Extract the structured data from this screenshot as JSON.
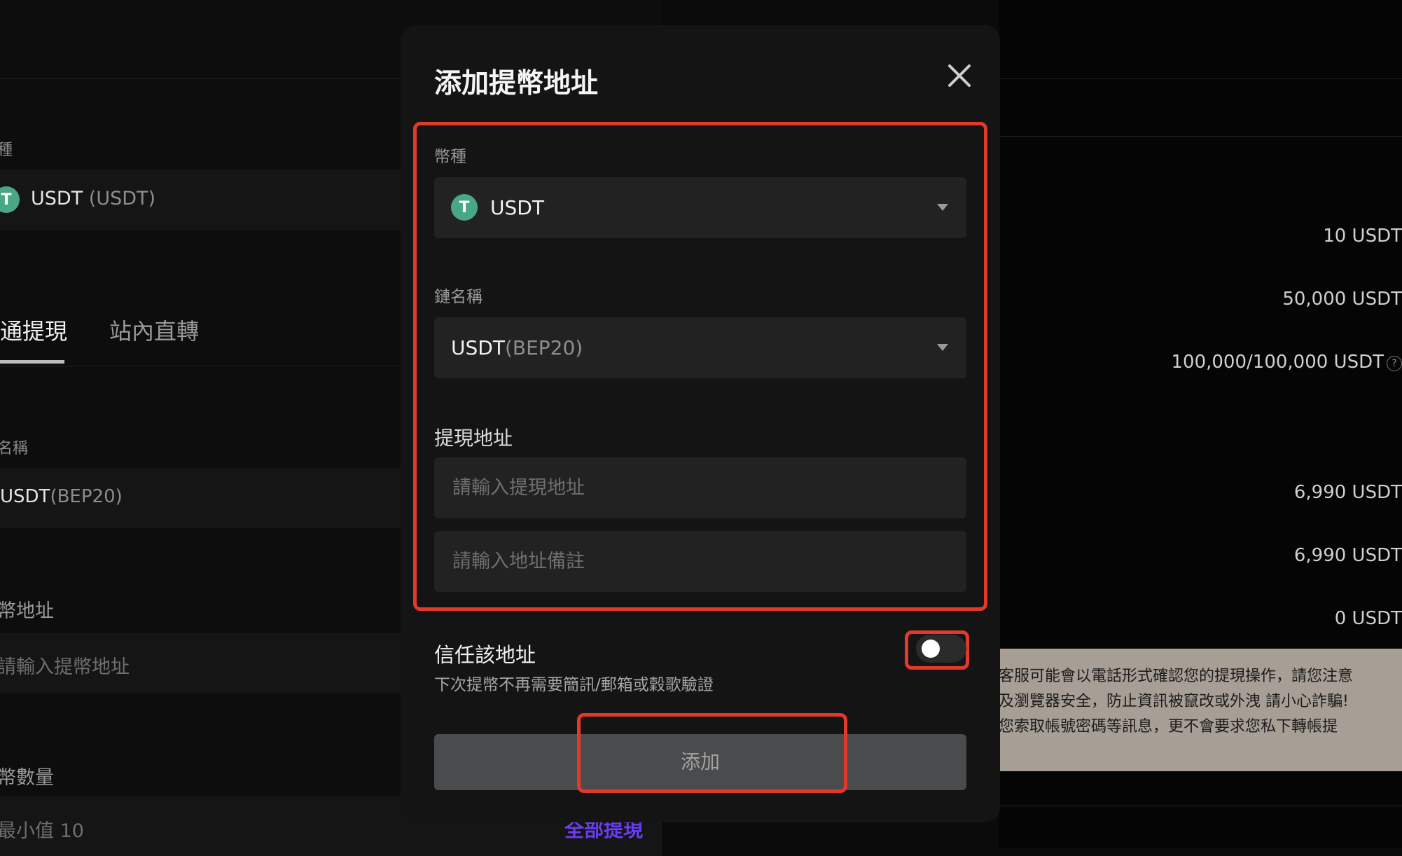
{
  "background": {
    "currency_label": "種",
    "currency_value": "USDT",
    "currency_code": "(USDT)",
    "tabs": [
      "通提現",
      "站內直轉"
    ],
    "chain_label": "名稱",
    "chain_value": "USDT",
    "chain_code": "(BEP20)",
    "address_label": "幣地址",
    "address_placeholder": "請輸入提幣地址",
    "amount_label": "幣數量",
    "amount_placeholder": "最小值 10",
    "withdraw_all_link": "全部提現",
    "right_values": [
      "10 USDT",
      "50,000 USDT",
      "100,000/100,000 USDT",
      "6,990 USDT",
      "6,990 USDT",
      "0 USDT"
    ],
    "help_glyph": "?",
    "notice_lines": [
      "客服可能會以電話形式確認您的提現操作，請您注意",
      "及瀏覽器安全，防止資訊被竄改或外洩 請小心詐騙!",
      "您索取帳號密碼等訊息，更不會要求您私下轉帳提"
    ]
  },
  "modal": {
    "title": "添加提幣地址",
    "currency_label": "幣種",
    "currency_value": "USDT",
    "chain_label": "鏈名稱",
    "chain_value": "USDT",
    "chain_code": "(BEP20)",
    "address_section": "提現地址",
    "address_placeholder": "請輸入提現地址",
    "remark_placeholder": "請輸入地址備註",
    "trust_title": "信任該地址",
    "trust_desc": "下次提幣不再需要簡訊/郵箱或穀歌驗證",
    "trust_toggle_on": false,
    "add_button": "添加",
    "coin_glyph": "T",
    "icons": {
      "close": "close-icon",
      "coin": "tether-icon",
      "dropdown": "chevron-down-icon"
    }
  },
  "colors": {
    "highlight": "#e2392a",
    "tether": "#48a885",
    "link": "#6a3cf2"
  }
}
